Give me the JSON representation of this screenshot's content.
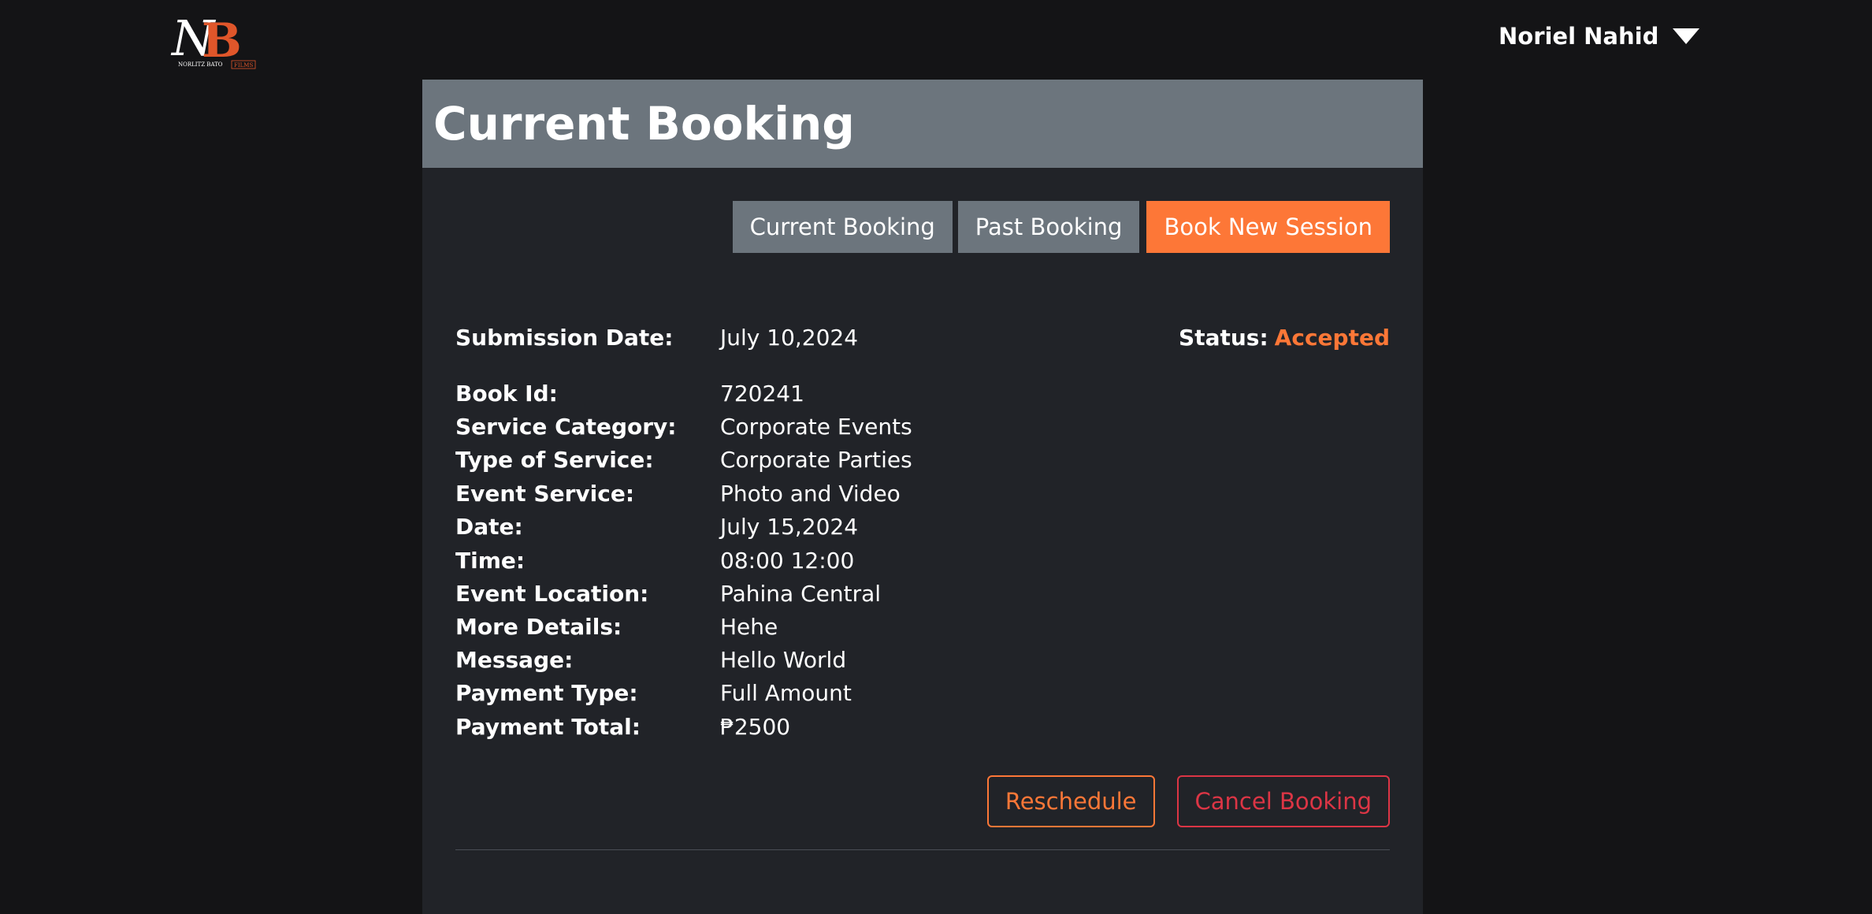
{
  "brand": {
    "logo_letters": "NB",
    "logo_text_left": "NORLITZ BATO",
    "logo_text_right": "FILMS",
    "accent_color": "#fd7737"
  },
  "user": {
    "name": "Noriel Nahid",
    "menu_icon": "caret-down-icon"
  },
  "page": {
    "title": "Current Booking"
  },
  "tabs": {
    "current": "Current Booking",
    "past": "Past Booking",
    "new": "Book New Session"
  },
  "booking": {
    "submission": {
      "label": "Submission Date:",
      "value": "July 10,2024"
    },
    "status": {
      "label": "Status:",
      "value": "Accepted",
      "color": "#fd7737"
    },
    "fields": [
      {
        "label": "Book Id:",
        "value": "720241"
      },
      {
        "label": "Service Category:",
        "value": "Corporate Events"
      },
      {
        "label": "Type of Service:",
        "value": "Corporate Parties"
      },
      {
        "label": "Event Service:",
        "value": "Photo and Video"
      },
      {
        "label": "Date:",
        "value": "July 15,2024"
      },
      {
        "label": "Time:",
        "value": "08:00 12:00"
      },
      {
        "label": "Event Location:",
        "value": "Pahina Central"
      },
      {
        "label": "More Details:",
        "value": "Hehe"
      },
      {
        "label": "Message:",
        "value": "Hello World"
      },
      {
        "label": "Payment Type:",
        "value": "Full Amount"
      },
      {
        "label": "Payment Total:",
        "value": "₱2500"
      }
    ]
  },
  "actions": {
    "reschedule": "Reschedule",
    "cancel": "Cancel Booking",
    "cancel_color": "#dc3545"
  }
}
